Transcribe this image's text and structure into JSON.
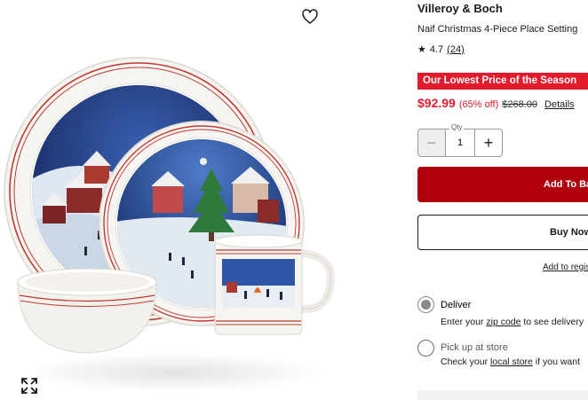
{
  "product": {
    "brand": "Villeroy & Boch",
    "name": "Naif Christmas 4-Piece Place Setting",
    "rating_star": "★",
    "rating_value": "4.7",
    "rating_count": "(24)"
  },
  "promo": {
    "badge": "Our Lowest Price of the Season"
  },
  "price": {
    "sale": "$92.99",
    "percent_off": "(65% off)",
    "original": "$268.00",
    "details_link": "Details"
  },
  "quantity": {
    "label": "Qty",
    "value": "1",
    "minus": "−",
    "plus": "+"
  },
  "actions": {
    "add_to_bag": "Add To Bag",
    "buy_now": "Buy Now",
    "add_to_registry": "Add to registry"
  },
  "fulfillment": {
    "deliver": {
      "title": "Deliver",
      "sub_prefix": "Enter your ",
      "sub_link": "zip code",
      "sub_suffix": " to see delivery"
    },
    "pickup": {
      "title": "Pick up at store",
      "sub_prefix": "Check your ",
      "sub_link": "local store",
      "sub_suffix": " if you want"
    },
    "selected": "deliver"
  },
  "icons": {
    "favorite": "heart-icon",
    "expand": "expand-icon"
  },
  "colors": {
    "promo_red": "#e11a2c",
    "bag_red": "#b0000d",
    "plate_rim_stripe": "#c0392b"
  }
}
